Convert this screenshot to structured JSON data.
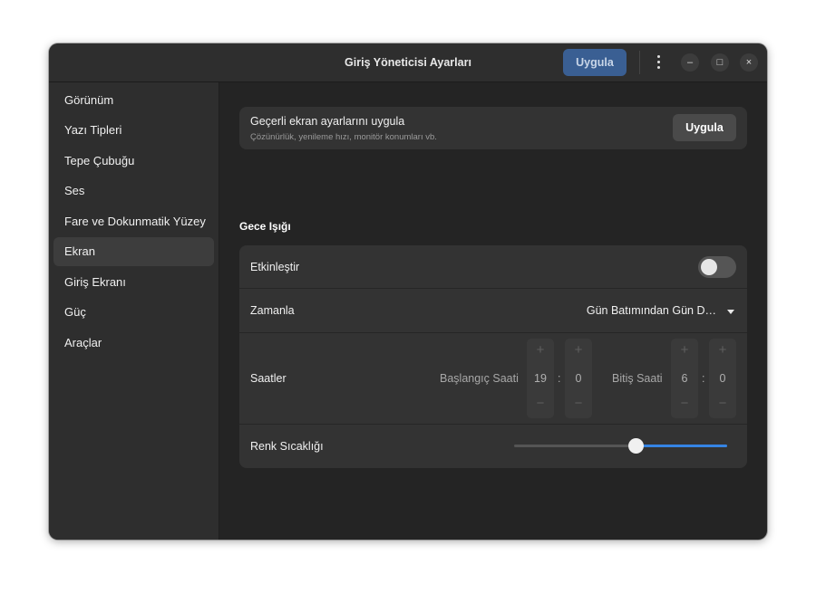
{
  "window": {
    "title": "Giriş Yöneticisi Ayarları",
    "apply_label": "Uygula",
    "menu_icon": "vertical-dots-icon",
    "minimize_glyph": "–",
    "maximize_glyph": "□",
    "close_glyph": "×"
  },
  "sidebar": {
    "items": [
      {
        "label": "Görünüm"
      },
      {
        "label": "Yazı Tipleri"
      },
      {
        "label": "Tepe Çubuğu"
      },
      {
        "label": "Ses"
      },
      {
        "label": "Fare ve Dokunmatik Yüzey"
      },
      {
        "label": "Ekran"
      },
      {
        "label": "Giriş Ekranı"
      },
      {
        "label": "Güç"
      },
      {
        "label": "Araçlar"
      }
    ],
    "active": "Ekran"
  },
  "apply_card": {
    "title": "Geçerli ekran ayarlarını uygula",
    "subtitle": "Çözünürlük, yenileme hızı, monitör konumları vb.",
    "button_label": "Uygula"
  },
  "night_light": {
    "heading": "Gece Işığı",
    "enable": {
      "label": "Etkinleştir",
      "on": false
    },
    "schedule": {
      "label": "Zamanla",
      "value": "Gün Batımından Gün D…"
    },
    "hours": {
      "label": "Saatler",
      "start_label": "Başlangıç Saati",
      "start_hour": "19",
      "start_minute": "0",
      "end_label": "Bitiş Saati",
      "end_hour": "6",
      "end_minute": "0",
      "separator": ":",
      "plus_glyph": "+",
      "minus_glyph": "−"
    },
    "temperature": {
      "label": "Renk Sıcaklığı",
      "level": 0.57
    }
  },
  "colors": {
    "accent": "#3584e4",
    "header_apply_bg": "#3a5f93",
    "window_bg": "#242424",
    "card_bg": "#333333"
  }
}
